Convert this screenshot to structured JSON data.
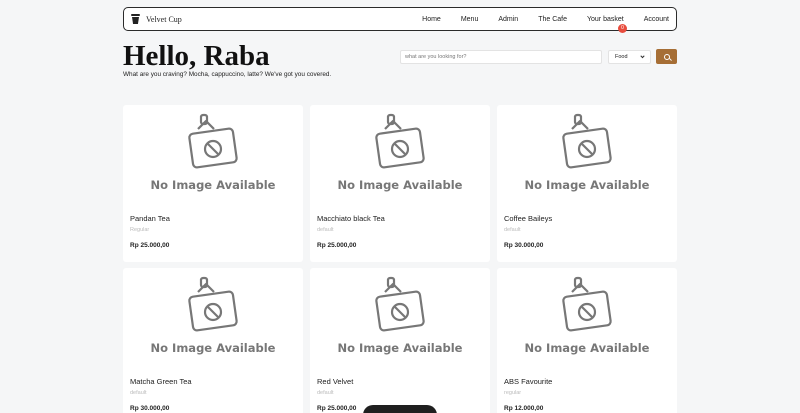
{
  "header": {
    "brand_name": "Velvet Cup",
    "nav": [
      {
        "label": "Home"
      },
      {
        "label": "Menu"
      },
      {
        "label": "Admin"
      },
      {
        "label": "The Cafe"
      },
      {
        "label": "Your basket",
        "badge": "0"
      },
      {
        "label": "Account"
      }
    ]
  },
  "hero": {
    "greeting": "Hello, Raba",
    "subtitle": "What are you craving? Mocha, cappuccino, latte? We've got you covered."
  },
  "search": {
    "placeholder": "what are you looking for?",
    "category_selected": "Food",
    "button_icon": "search-icon"
  },
  "colors": {
    "accent": "#a66e35",
    "badge": "#e84c3d"
  },
  "products": [
    {
      "name": "Pandan Tea",
      "variant": "Regular",
      "price": "Rp 25.000,00",
      "image_text": "No Image Available"
    },
    {
      "name": "Macchiato black Tea",
      "variant": "default",
      "price": "Rp 25.000,00",
      "image_text": "No Image Available"
    },
    {
      "name": "Coffee Baileys",
      "variant": "default",
      "price": "Rp 30.000,00",
      "image_text": "No Image Available"
    },
    {
      "name": "Matcha Green Tea",
      "variant": "default",
      "price": "Rp 30.000,00",
      "image_text": "No Image Available"
    },
    {
      "name": "Red Velvet",
      "variant": "default",
      "price": "Rp 25.000,00",
      "image_text": "No Image Available"
    },
    {
      "name": "ABS Favourite",
      "variant": "regular",
      "price": "Rp 12.000,00",
      "image_text": "No Image Available"
    }
  ]
}
